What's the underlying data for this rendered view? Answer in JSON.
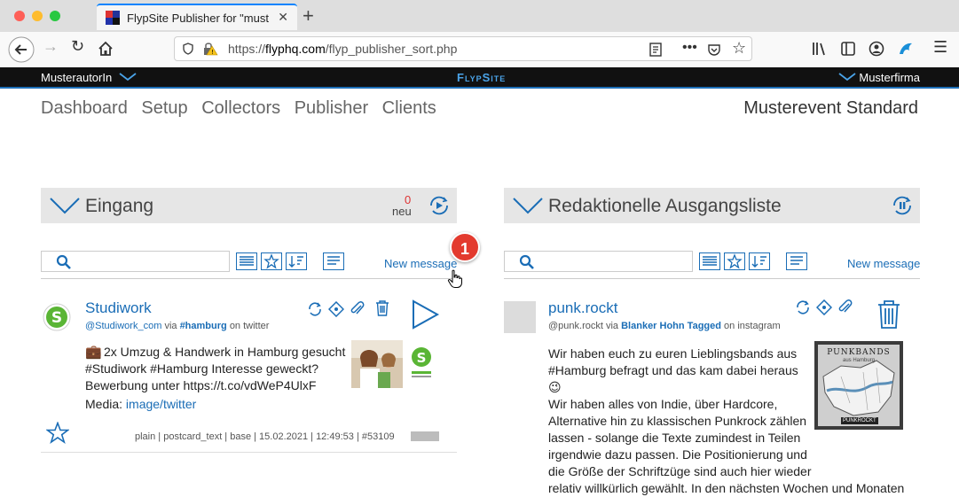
{
  "browser": {
    "tab_title": "FlypSite Publisher for \"musterfi",
    "url_prefix": "https://",
    "url_host": "flyphq.com",
    "url_path": "/flyp_publisher_sort.php"
  },
  "topbar": {
    "author": "MusterautorIn",
    "brand": "FlypSite",
    "company": "Musterfirma"
  },
  "nav": {
    "items": [
      "Dashboard",
      "Setup",
      "Collectors",
      "Publisher",
      "Clients"
    ],
    "event": "Musterevent Standard"
  },
  "left_panel": {
    "title": "Eingang",
    "count": "0",
    "count_label": "neu",
    "new_message": "New message",
    "card": {
      "name": "Studiwork",
      "handle": "@Studiwork_com",
      "via": "via",
      "tag": "#hamburg",
      "source": "on twitter",
      "text_line1": "2x Umzug & Handwerk in Hamburg gesucht",
      "text_line2": "#Studiwork #Hamburg Interesse geweckt?",
      "text_line3": "Bewerbung unter https://t.co/vdWeP4UlxF",
      "media_label": "Media:",
      "media_link": "image/twitter",
      "footer": "plain | postcard_text | base | 15.02.2021 | 12:49:53 | #53109"
    }
  },
  "right_panel": {
    "title": "Redaktionelle Ausgangsliste",
    "new_message": "New message",
    "card": {
      "name": "punk.rockt",
      "handle": "@punk.rockt",
      "via": "via",
      "tag": "Blanker Hohn Tagged",
      "source": "on instagram",
      "lines": [
        "Wir haben euch zu euren Lieblingsbands aus",
        "#Hamburg befragt und das kam dabei heraus 😉",
        "Wir haben alles von Indie, über Hardcore,",
        "Alternative hin zu klassischen Punkrock zählen",
        "lassen - solange die Texte zumindest in Teilen",
        "irgendwie dazu passen. Die Positionierung und",
        "die Größe der Schriftzüge sind auch hier wieder",
        "relativ willkürlich gewählt. In den nächsten Wochen und Monaten"
      ],
      "image_caption_top": "PUNKBANDS",
      "image_caption_sub": "aus Hamburg",
      "image_caption_bottom": "PUNKROCKT"
    }
  },
  "annotation": {
    "badge": "1"
  },
  "colors": {
    "accent": "#1a6db6",
    "badge": "#e33a2e",
    "topbar": "#111111"
  }
}
